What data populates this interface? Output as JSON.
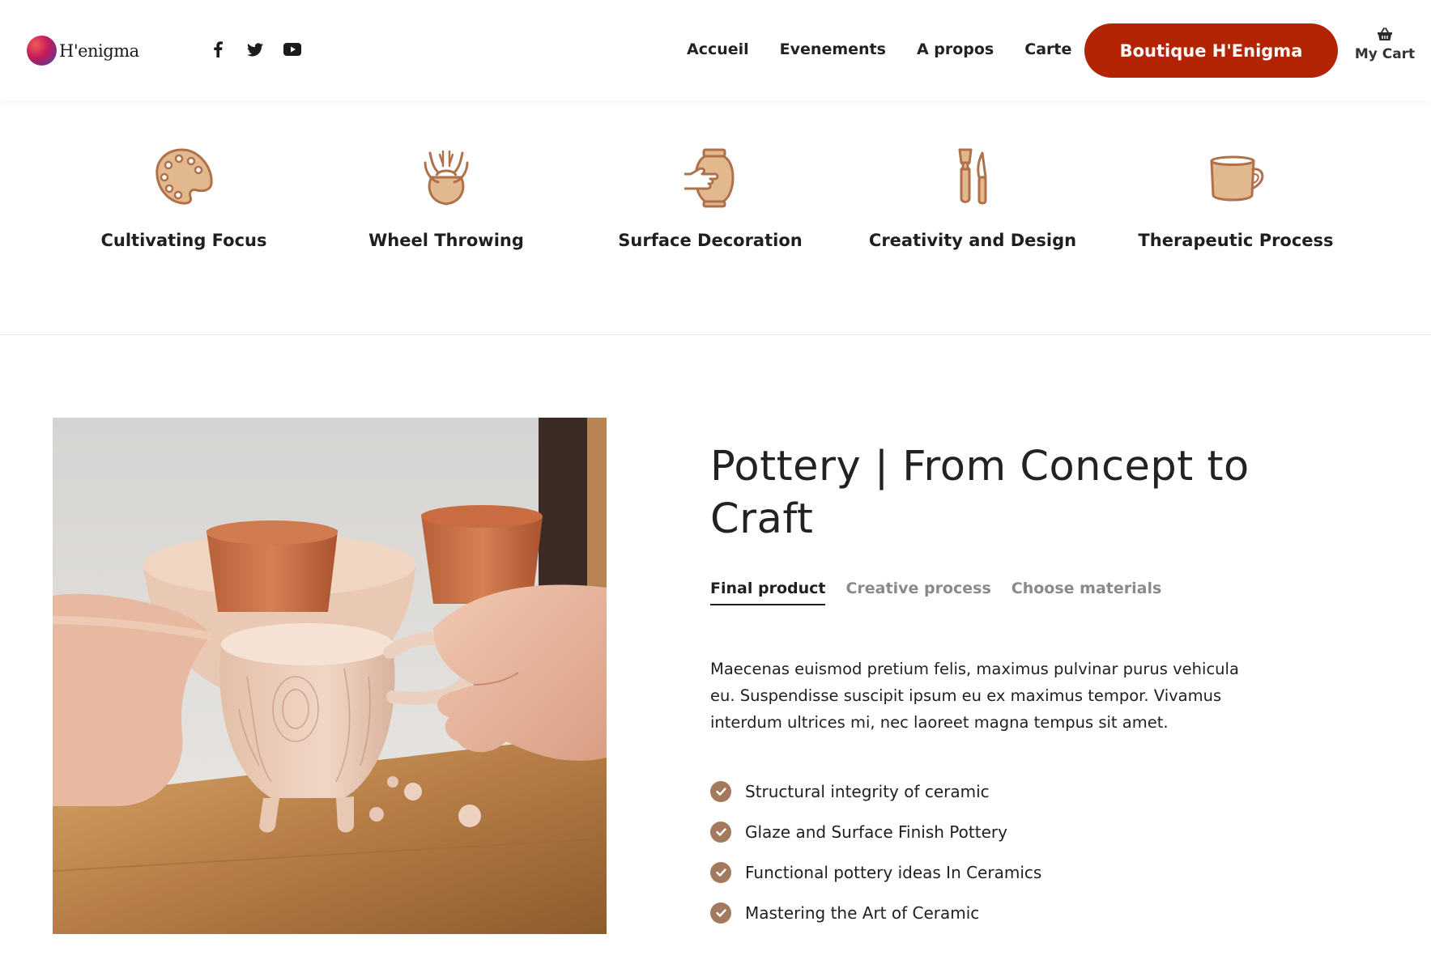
{
  "brand": {
    "name": "H'enigma"
  },
  "social": [
    "facebook-icon",
    "twitter-icon",
    "youtube-icon"
  ],
  "nav": {
    "items": [
      {
        "label": "Accueil"
      },
      {
        "label": "Evenements"
      },
      {
        "label": "A propos"
      },
      {
        "label": "Carte"
      }
    ],
    "shop_button": "Boutique H'Enigma",
    "cart_label": "My Cart"
  },
  "features": [
    {
      "label": "Cultivating Focus",
      "icon": "palette-icon"
    },
    {
      "label": "Wheel Throwing",
      "icon": "pottery-wheel-icon"
    },
    {
      "label": "Surface Decoration",
      "icon": "vase-hand-icon"
    },
    {
      "label": "Creativity and Design",
      "icon": "tools-icon"
    },
    {
      "label": "Therapeutic Process",
      "icon": "cup-icon"
    }
  ],
  "main": {
    "title": "Pottery | From Concept to Craft",
    "tabs": [
      {
        "label": "Final product",
        "active": true
      },
      {
        "label": "Creative process",
        "active": false
      },
      {
        "label": "Choose materials",
        "active": false
      }
    ],
    "description": "Maecenas euismod pretium felis, maximus pulvinar purus vehicula eu. Suspendisse suscipit ipsum eu ex maximus tempor. Vivamus interdum ultrices mi, nec laoreet magna tempus sit amet.",
    "checklist": [
      "Structural integrity of ceramic",
      "Glaze and Surface Finish Pottery",
      "Functional pottery ideas In Ceramics",
      "Mastering the Art of Ceramic"
    ]
  },
  "colors": {
    "accent": "#b32405",
    "icon_stroke": "#b0704a",
    "icon_fill": "#e2b98f",
    "check": "#a47a5e"
  }
}
